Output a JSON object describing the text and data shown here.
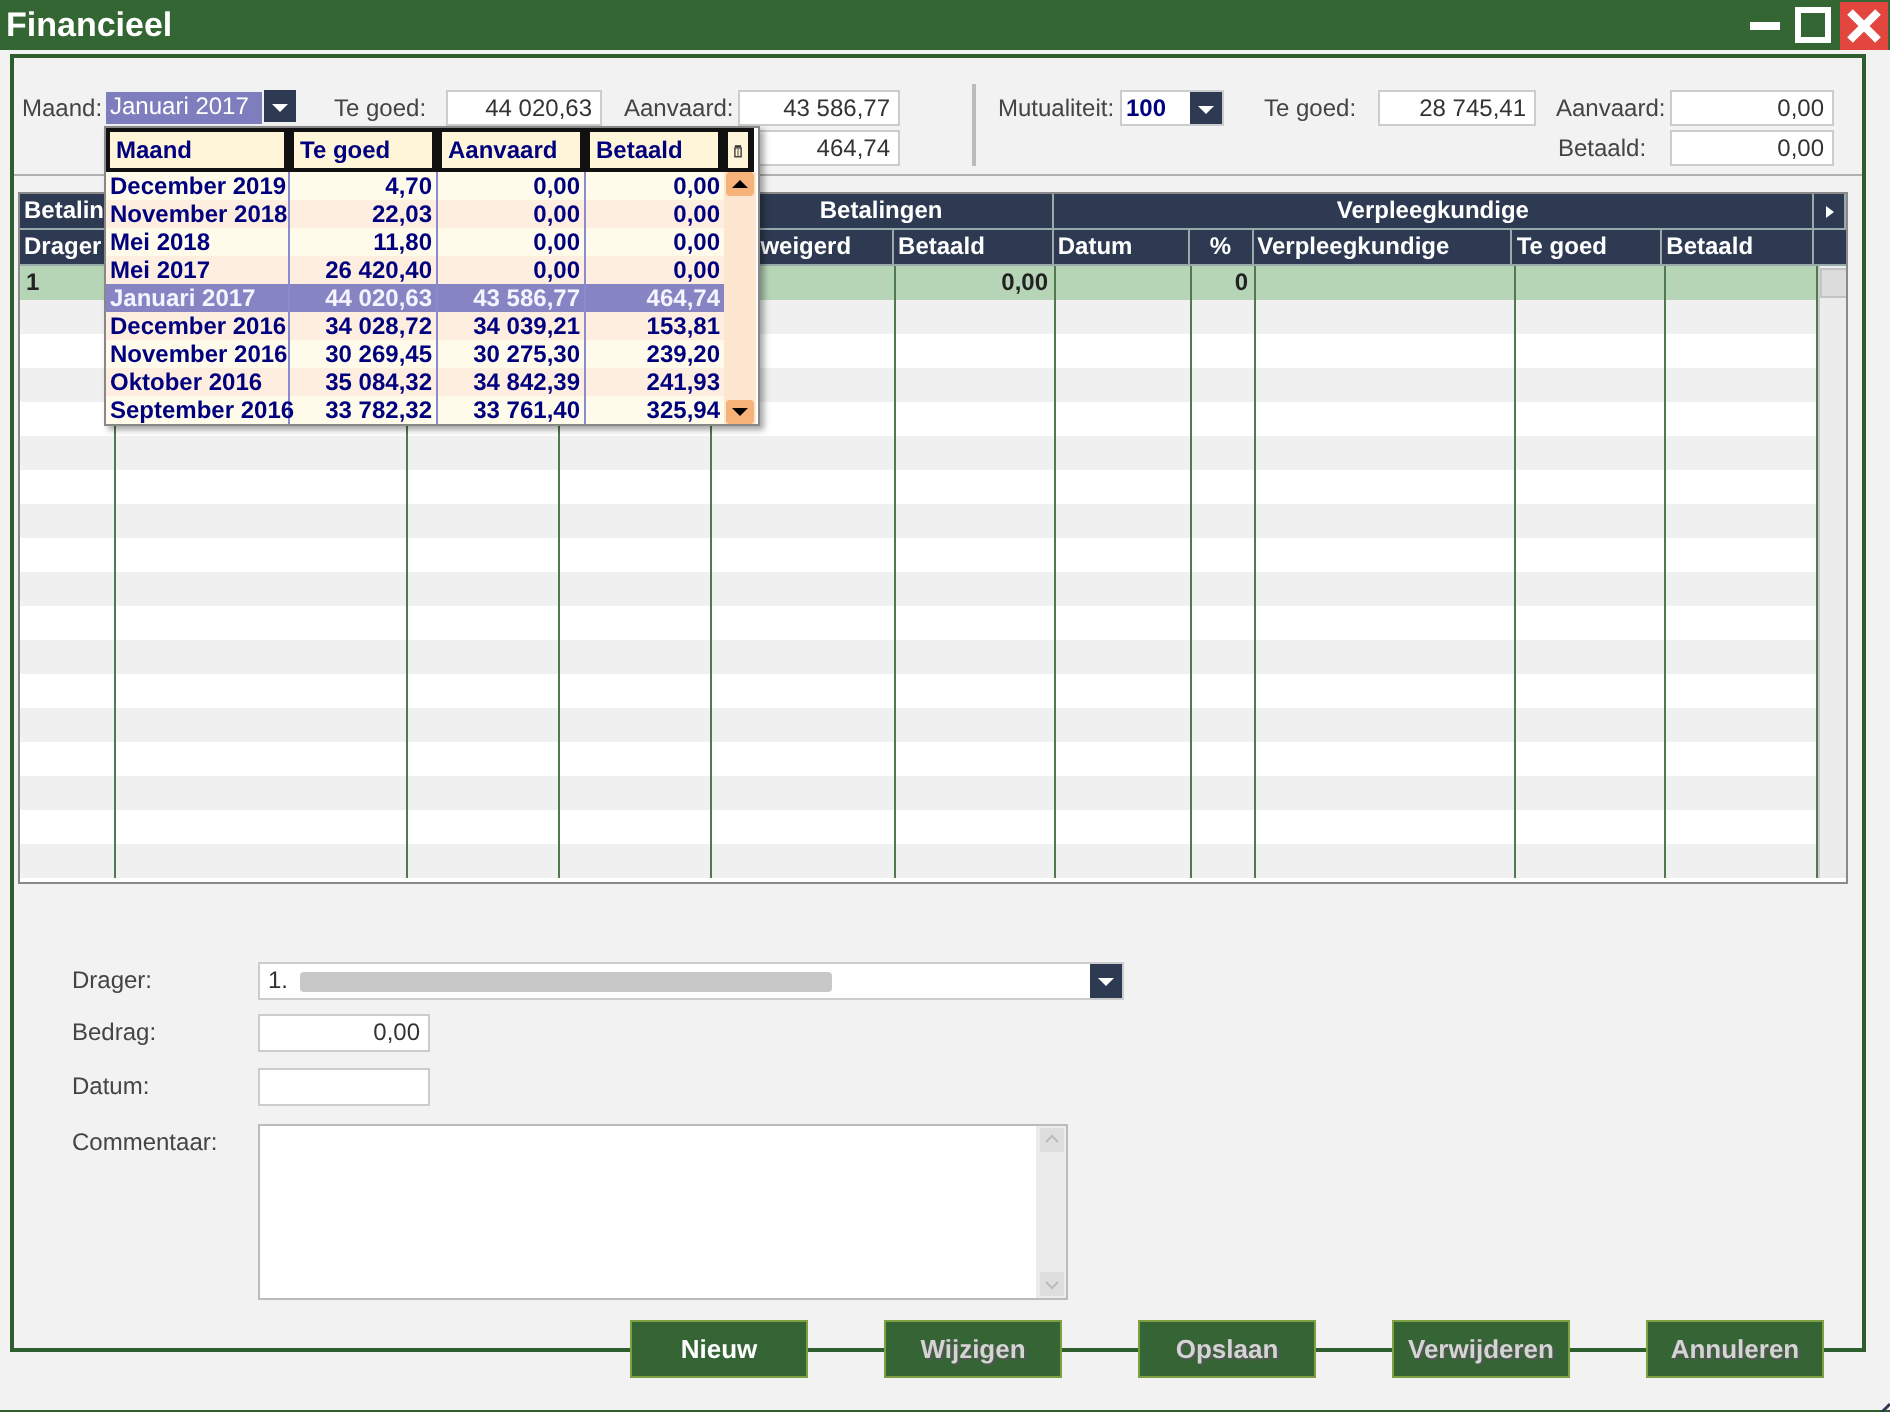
{
  "window": {
    "title": "Financieel"
  },
  "period": {
    "month_label": "Maand:",
    "month_value": "Januari 2017",
    "te_goed_label": "Te goed:",
    "te_goed": "44 020,63",
    "aanvaard_label": "Aanvaard:",
    "aanvaard": "43 586,77",
    "betaald": "464,74"
  },
  "mutuality": {
    "label": "Mutualiteit:",
    "value": "100",
    "te_goed_label": "Te goed:",
    "te_goed": "28 745,41",
    "aanvaard_label": "Aanvaard:",
    "aanvaard": "0,00",
    "betaald_label": "Betaald:",
    "betaald": "0,00"
  },
  "month_dropdown": {
    "columns": [
      "Maand",
      "Te goed",
      "Aanvaard",
      "Betaald"
    ],
    "rows": [
      {
        "month": "December 2019",
        "te_goed": "4,70",
        "aanvaard": "0,00",
        "betaald": "0,00",
        "selected": false
      },
      {
        "month": "November 2018",
        "te_goed": "22,03",
        "aanvaard": "0,00",
        "betaald": "0,00",
        "selected": false
      },
      {
        "month": "Mei 2018",
        "te_goed": "11,80",
        "aanvaard": "0,00",
        "betaald": "0,00",
        "selected": false
      },
      {
        "month": "Mei 2017",
        "te_goed": "26 420,40",
        "aanvaard": "0,00",
        "betaald": "0,00",
        "selected": false
      },
      {
        "month": "Januari 2017",
        "te_goed": "44 020,63",
        "aanvaard": "43 586,77",
        "betaald": "464,74",
        "selected": true
      },
      {
        "month": "December 2016",
        "te_goed": "34 028,72",
        "aanvaard": "34 039,21",
        "betaald": "153,81",
        "selected": false
      },
      {
        "month": "November 2016",
        "te_goed": "30 269,45",
        "aanvaard": "30 275,30",
        "betaald": "239,20",
        "selected": false
      },
      {
        "month": "Oktober 2016",
        "te_goed": "35 084,32",
        "aanvaard": "34 842,39",
        "betaald": "241,93",
        "selected": false
      },
      {
        "month": "September 2016",
        "te_goed": "33 782,32",
        "aanvaard": "33 761,40",
        "betaald": "325,94",
        "selected": false
      }
    ]
  },
  "grid": {
    "groups": [
      "Betalin",
      "Betalingen",
      "Verpleegkundige"
    ],
    "columns": [
      "Drager",
      "weigerd",
      "Betaald",
      "Datum",
      "%",
      "Verpleegkundige",
      "Te goed",
      "Betaald"
    ],
    "rows": [
      {
        "selected": true,
        "drager": "1",
        "betaald": "0,00",
        "percent": "0"
      }
    ]
  },
  "form": {
    "drager_label": "Drager:",
    "drager_value": "1.",
    "bedrag_label": "Bedrag:",
    "bedrag": "0,00",
    "datum_label": "Datum:",
    "commentaar_label": "Commentaar:"
  },
  "buttons": [
    {
      "label": "Nieuw",
      "disabled": false
    },
    {
      "label": "Wijzigen",
      "disabled": true
    },
    {
      "label": "Opslaan",
      "disabled": true
    },
    {
      "label": "Verwijderen",
      "disabled": true
    },
    {
      "label": "Annuleren",
      "disabled": true
    }
  ]
}
